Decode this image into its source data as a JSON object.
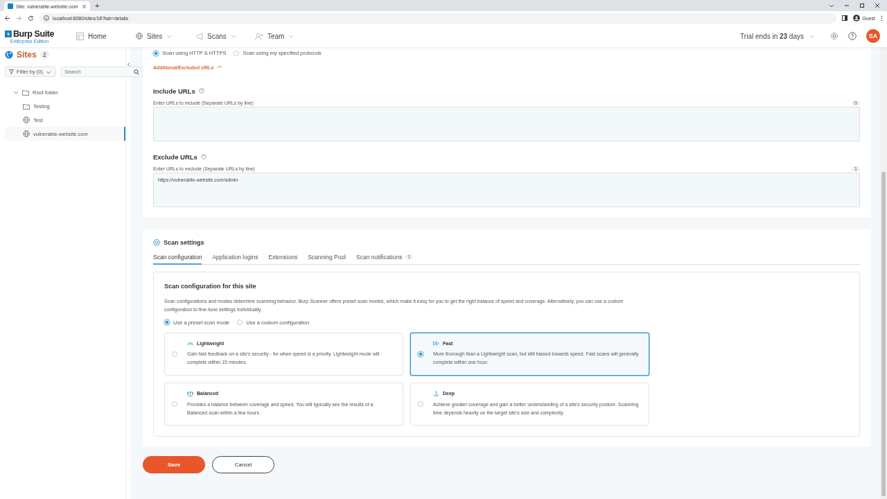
{
  "browser": {
    "tab_title": "Site: vulnerable-website.com",
    "new_tab": "+",
    "url": "localhost:8080/sites/18?tab=details",
    "profile": "Guest"
  },
  "header": {
    "logo": "Burp Suite",
    "edition": "Enterprise Edition",
    "nav": [
      {
        "label": "Home",
        "dropdown": false
      },
      {
        "label": "Sites",
        "dropdown": true
      },
      {
        "label": "Scans",
        "dropdown": true
      },
      {
        "label": "Team",
        "dropdown": true
      }
    ],
    "trial": "Trial ends in **23** days",
    "avatar": "SA"
  },
  "sidebar": {
    "title": "Sites",
    "count": "2",
    "filter": "Filter by (0)",
    "search_placeholder": "Search",
    "tree": [
      {
        "label": "Root folder",
        "kind": "folder",
        "expanded": true,
        "selected": false,
        "children": [
          {
            "label": "Testing",
            "kind": "folder",
            "selected": false
          },
          {
            "label": "Test",
            "kind": "site",
            "selected": false
          },
          {
            "label": "vulnerable-website.com",
            "kind": "site",
            "selected": true
          }
        ]
      }
    ]
  },
  "protocols": [
    {
      "label": "Scan using HTTP & HTTPS",
      "selected": true
    },
    {
      "label": "Scan using my specified protocols",
      "selected": false
    }
  ],
  "urls_toggle": {
    "label": "Additional/Excluded URLs",
    "expanded": true
  },
  "url_fields": [
    {
      "title": "Include URLs",
      "hint": "Enter URLs to include (Separate URLs by line)",
      "count": "0"
    },
    {
      "title": "Exclude URLs",
      "hint": "Enter URLs to exclude (Separate URLs by line)",
      "count": "1",
      "value": "https://vulnerable-website.com/admin"
    }
  ],
  "scan_settings": {
    "title": "Scan settings",
    "tabs": [
      {
        "label": "Scan configuration",
        "selected": true
      },
      {
        "label": "Application logins",
        "selected": false
      },
      {
        "label": "Extensions",
        "selected": false
      },
      {
        "label": "Scanning Pool",
        "selected": false
      },
      {
        "label": "Scan notifications",
        "badge": "1",
        "selected": false
      }
    ],
    "panel_title": "Scan configuration for this site",
    "description": "Scan configurations and modes determine scanning behavior. Burp Scanner offers preset scan modes, which make it easy for you to get the right balance of speed and coverage. Alternatively, you can use a custom configuration to fine-tune settings individually.",
    "config_options": [
      {
        "label": "Use a preset scan mode",
        "selected": true
      },
      {
        "label": "Use a custom configuration",
        "selected": false
      }
    ],
    "modes": [
      {
        "name": "Lightweight",
        "description": "Gain fast feedback on a site's security - for when speed is a priority. Lightweight mode will complete within 15 minutes.",
        "selected": false
      },
      {
        "name": "Fast",
        "description": "More thorough than a Lightweight scan, but still biased towards speed. Fast scans will generally complete within one hour.",
        "selected": true
      },
      {
        "name": "Balanced",
        "description": "Provides a balance between coverage and speed. You will typically see the results of a Balanced scan within a few hours.",
        "selected": false
      },
      {
        "name": "Deep",
        "description": "Achieve greater coverage and gain a better understanding of a site's security posture. Scanning time depends heavily on the target site's size and complexity.",
        "selected": false
      }
    ]
  },
  "actions": [
    {
      "label": "Save",
      "kind": "primary"
    },
    {
      "label": "Cancel",
      "kind": "secondary"
    }
  ]
}
